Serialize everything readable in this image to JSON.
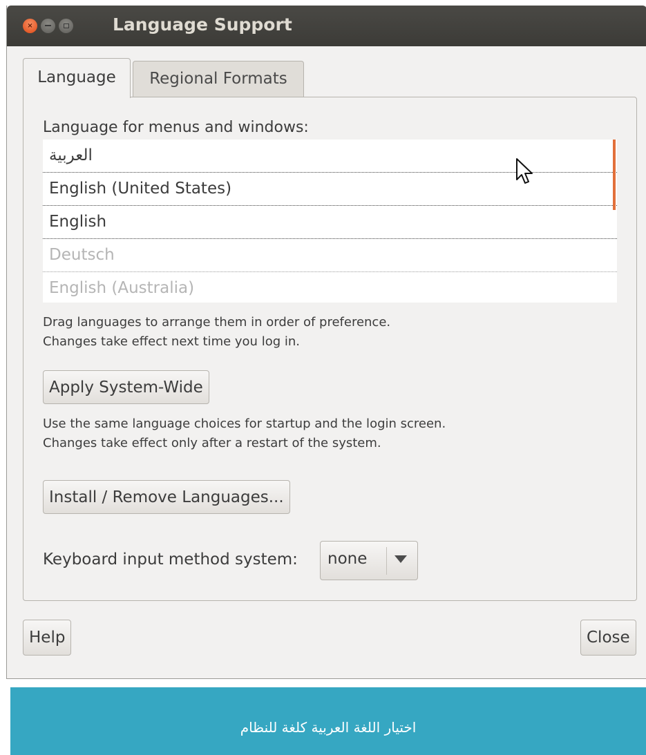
{
  "window": {
    "title": "Language Support"
  },
  "tabs": [
    {
      "label": "Language",
      "active": true
    },
    {
      "label": "Regional Formats",
      "active": false
    }
  ],
  "language_section": {
    "heading": "Language for menus and windows:",
    "items": [
      {
        "label": "العربية",
        "enabled": true
      },
      {
        "label": "English (United States)",
        "enabled": true
      },
      {
        "label": "English",
        "enabled": true
      },
      {
        "label": "Deutsch",
        "enabled": false
      },
      {
        "label": "English (Australia)",
        "enabled": false
      }
    ],
    "hint_line1": "Drag languages to arrange them in order of preference.",
    "hint_line2": "Changes take effect next time you log in."
  },
  "apply_button": "Apply System-Wide",
  "apply_hint_line1": "Use the same language choices for startup and the login screen.",
  "apply_hint_line2": "Changes take effect only after a restart of the system.",
  "install_button": "Install / Remove Languages...",
  "keyboard": {
    "label": "Keyboard input method system:",
    "selected": "none"
  },
  "footer": {
    "help_button": "Help",
    "close_button": "Close"
  },
  "banner": {
    "text": "اختيار اللغة العربية كلغة للنظام"
  },
  "colors": {
    "accent": "#e2703a",
    "banner": "#36a7c2",
    "titlebar": "#3c3b37",
    "close_button": "#df4a16"
  }
}
